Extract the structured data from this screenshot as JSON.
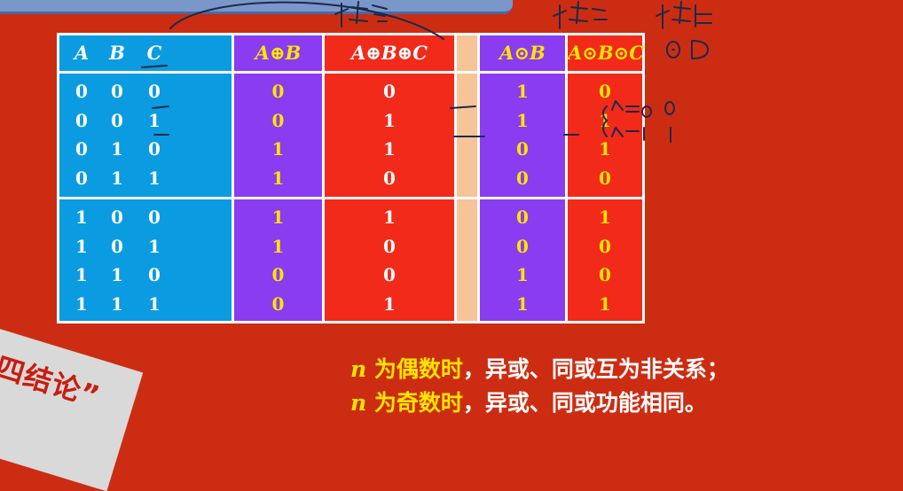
{
  "headers": {
    "a": "A",
    "b": "B",
    "c": "C",
    "a_xor_b": "A⊕B",
    "a_xor_b_xor_c": "A⊕B⊕C",
    "a_xnor_b": "A⊙B",
    "a_xnor_b_xnor_c": "A⊙B⊙C"
  },
  "rows": [
    {
      "a": "0",
      "b": "0",
      "c": "0",
      "ab": "0",
      "abc": "0",
      "xb": "1",
      "xbc": "0"
    },
    {
      "a": "0",
      "b": "0",
      "c": "1",
      "ab": "0",
      "abc": "1",
      "xb": "1",
      "xbc": "1"
    },
    {
      "a": "0",
      "b": "1",
      "c": "0",
      "ab": "1",
      "abc": "1",
      "xb": "0",
      "xbc": "1"
    },
    {
      "a": "0",
      "b": "1",
      "c": "1",
      "ab": "1",
      "abc": "0",
      "xb": "0",
      "xbc": "0"
    },
    {
      "a": "1",
      "b": "0",
      "c": "0",
      "ab": "1",
      "abc": "1",
      "xb": "0",
      "xbc": "1"
    },
    {
      "a": "1",
      "b": "0",
      "c": "1",
      "ab": "1",
      "abc": "0",
      "xb": "0",
      "xbc": "0"
    },
    {
      "a": "1",
      "b": "1",
      "c": "0",
      "ab": "0",
      "abc": "0",
      "xb": "1",
      "xbc": "0"
    },
    {
      "a": "1",
      "b": "1",
      "c": "1",
      "ab": "0",
      "abc": "1",
      "xb": "1",
      "xbc": "1"
    }
  ],
  "conclusions": [
    {
      "n": "n",
      "key": "为偶数时",
      "text": "，异或、同或互为非关系；"
    },
    {
      "n": "n",
      "key": "为奇数时",
      "text": "，异或、同或功能相同。"
    }
  ],
  "banner": "四结论”",
  "colors": {
    "background": "#cc2d12",
    "abc_column": "#0b9be0",
    "purple_column": "#8a3cf0",
    "red_column": "#f12a1a",
    "gap_column": "#f6c497",
    "yellow_text": "#ffe400"
  }
}
